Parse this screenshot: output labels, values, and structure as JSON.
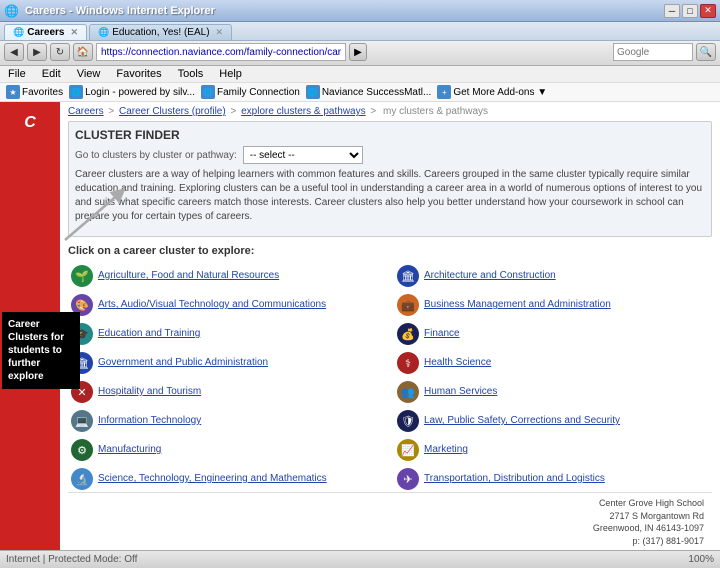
{
  "window": {
    "title": "Careers - Windows Internet Explorer",
    "controls": {
      "minimize": "─",
      "maximize": "□",
      "close": "✕"
    }
  },
  "browser": {
    "address": "https://connection.naviance.com/family-connection/career/explore",
    "search_placeholder": "Google",
    "tabs": [
      {
        "label": "Careers",
        "active": true
      },
      {
        "label": "Education, Yes! (EAL)",
        "active": false
      }
    ],
    "menu": [
      "File",
      "Edit",
      "View",
      "Favorites",
      "Tools",
      "Help"
    ],
    "favorites": [
      {
        "label": "Favorites"
      },
      {
        "label": "Login - powered by silv..."
      },
      {
        "label": "Family Connection"
      },
      {
        "label": "Naviance SuccessMatl..."
      },
      {
        "label": "Get More Add-ons ▼"
      }
    ]
  },
  "breadcrumb": {
    "items": [
      "Careers",
      "Career Clusters (profile)",
      "explore clusters & pathways",
      "my clusters & pathways"
    ]
  },
  "page": {
    "title": "explore clusters & pathways",
    "cluster_header_title": "CLUSTER FINDER",
    "filter_label": "Go to clusters by cluster or pathway: [- select -]",
    "description": "Career clusters are a way of helping learners with common features and skills. Careers grouped in the same cluster typically require similar education and training. Exploring clusters can be a useful tool in understanding a career area in a world of numerous options of interest to you and suits what specific careers match those interests. Career clusters also help you better understand how your coursework in school can prepare you for certain types of careers.",
    "explore_label": "Click on a career cluster to explore:",
    "clusters": [
      {
        "icon": "🌱",
        "color": "cluster-icon-green",
        "label": "Agriculture, Food and Natural Resources"
      },
      {
        "icon": "🏛",
        "color": "cluster-icon-blue",
        "label": "Architecture and Construction"
      },
      {
        "icon": "🎨",
        "color": "cluster-icon-purple",
        "label": "Arts, Audio/Visual Technology and Communications"
      },
      {
        "icon": "💼",
        "color": "cluster-icon-orange",
        "label": "Business Management and Administration"
      },
      {
        "icon": "🎓",
        "color": "cluster-icon-teal",
        "label": "Education and Training"
      },
      {
        "icon": "💰",
        "color": "cluster-icon-darkblue",
        "label": "Finance"
      },
      {
        "icon": "🏛",
        "color": "cluster-icon-blue",
        "label": "Government and Public Administration"
      },
      {
        "icon": "⚕",
        "color": "cluster-icon-red",
        "label": "Health Science"
      },
      {
        "icon": "✕",
        "color": "cluster-icon-red",
        "label": "Hospitality and Tourism"
      },
      {
        "icon": "👥",
        "color": "cluster-icon-brown",
        "label": "Human Services"
      },
      {
        "icon": "💻",
        "color": "cluster-icon-gray",
        "label": "Information Technology"
      },
      {
        "icon": "🛡",
        "color": "cluster-icon-darkblue",
        "label": "Law, Public Safety, Corrections and Security"
      },
      {
        "icon": "⚙",
        "color": "cluster-icon-darkgreen",
        "label": "Manufacturing"
      },
      {
        "icon": "📈",
        "color": "cluster-icon-yellow",
        "label": "Marketing"
      },
      {
        "icon": "🔬",
        "color": "cluster-icon-lightblue",
        "label": "Science, Technology, Engineering and Mathematics"
      },
      {
        "icon": "✈",
        "color": "cluster-icon-purple",
        "label": "Transportation, Distribution and Logistics"
      }
    ]
  },
  "school": {
    "name": "Center Grove High School",
    "address": "2717 S Morgantown Rd",
    "city_state_zip": "Greenwood, IN 46143-1097",
    "phone": "p: (317) 881-9017"
  },
  "annotation": {
    "text": "Career Clusters for students to further explore"
  },
  "status_bar": {
    "zone": "Internet | Protected Mode: Off",
    "zoom": "100%"
  }
}
